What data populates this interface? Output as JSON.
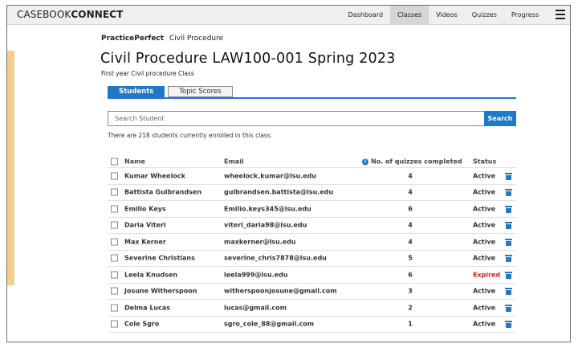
{
  "app": {
    "logo_light": "CASEBOOK",
    "logo_bold": "CONNECT"
  },
  "nav": {
    "items": [
      {
        "label": "Dashboard"
      },
      {
        "label": "Classes"
      },
      {
        "label": "Videos"
      },
      {
        "label": "Quizzes"
      },
      {
        "label": "Progress"
      }
    ],
    "active": "Classes"
  },
  "breadcrumb": {
    "brand": "PracticePerfect",
    "section": "Civil Procedure"
  },
  "page": {
    "title": "Civil Procedure LAW100-001 Spring 2023",
    "subtitle": "First year Civil procedure Class"
  },
  "tabs": [
    {
      "label": "Students",
      "active": true
    },
    {
      "label": "Topic Scores",
      "active": false
    }
  ],
  "search": {
    "placeholder": "Search Student",
    "value": "",
    "button_label": "Search"
  },
  "enrolled_text": "There are 218 students currently enrolled in this class.",
  "table": {
    "headers": {
      "name": "Name",
      "email": "Email",
      "quizzes": "No. of quizzes completed",
      "status": "Status"
    },
    "rows": [
      {
        "name": "Kumar Wheelock",
        "email": "wheelock.kumar@lsu.edu",
        "quizzes": "4",
        "status": "Active"
      },
      {
        "name": "Battista Gulbrandsen",
        "email": "gulbrandsen.battista@lsu.edu",
        "quizzes": "4",
        "status": "Active"
      },
      {
        "name": "Emilio Keys",
        "email": "Emilio.keys345@lsu.edu",
        "quizzes": "6",
        "status": "Active"
      },
      {
        "name": "Daria Viteri",
        "email": "viteri_daria98@lsu.edu",
        "quizzes": "4",
        "status": "Active"
      },
      {
        "name": "Max Kerner",
        "email": "maxkerner@lsu.edu",
        "quizzes": "4",
        "status": "Active"
      },
      {
        "name": "Severine Christians",
        "email": "severine_chris7878@lsu.edu",
        "quizzes": "5",
        "status": "Active"
      },
      {
        "name": "Leela Knudsen",
        "email": "leela999@lsu.edu",
        "quizzes": "6",
        "status": "Expired"
      },
      {
        "name": "Josune Witherspoon",
        "email": "witherspoonjosune@gmail.com",
        "quizzes": "3",
        "status": "Active"
      },
      {
        "name": "Delma Lucas",
        "email": "lucas@gmail.com",
        "quizzes": "2",
        "status": "Active"
      },
      {
        "name": "Cole Sgro",
        "email": "sgro_cole_88@gmail.com",
        "quizzes": "1",
        "status": "Active"
      }
    ]
  },
  "icons": {
    "info": "info-icon",
    "delete": "trash-icon",
    "menu": "hamburger-menu-icon"
  },
  "colors": {
    "accent": "#1f78c8",
    "expired": "#d51d1d",
    "side_panel": "#f4cf8a"
  }
}
